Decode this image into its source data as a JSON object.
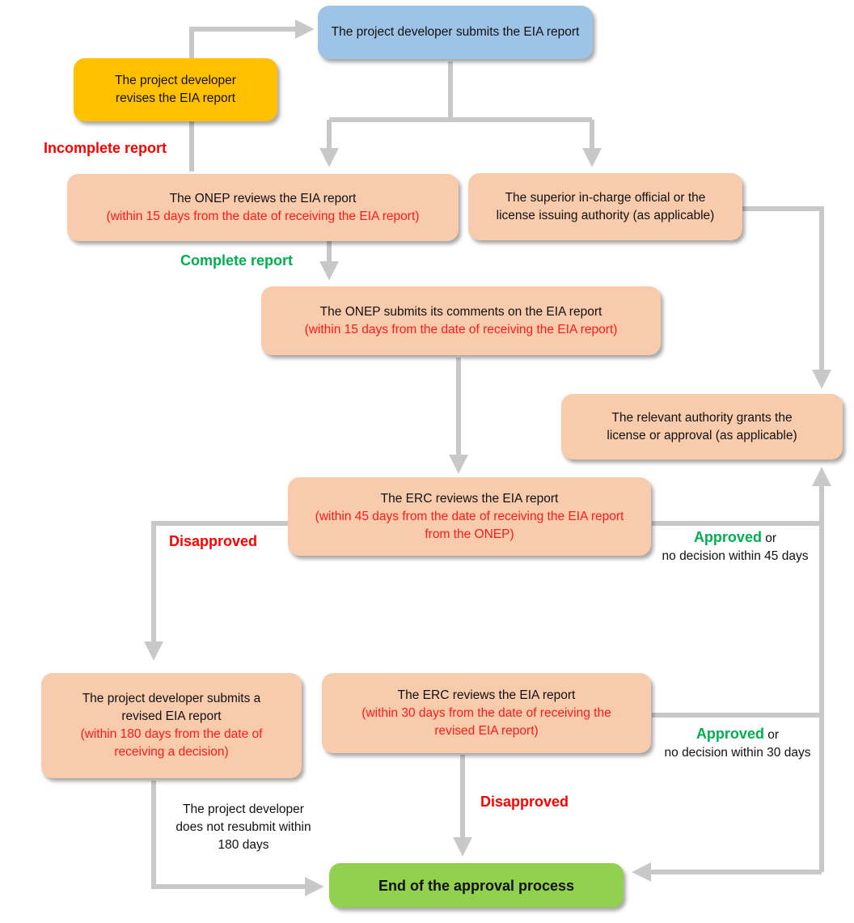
{
  "colors": {
    "submit_box": "#9dc3e6",
    "revise_box": "#ffc000",
    "process_box": "#f8cbad",
    "end_box": "#92d050",
    "deadline_text": "#ff1a1a",
    "negative_label": "#ff0000",
    "positive_label": "#00b050",
    "connector": "#c8c8c8"
  },
  "nodes": {
    "submit": {
      "text": "The project developer submits the EIA report"
    },
    "revise": {
      "text": "The project developer revises the EIA report"
    },
    "onep_review": {
      "text": "The ONEP reviews the EIA report",
      "note": "(within 15 days from the date of receiving the EIA report)"
    },
    "superior": {
      "text": "The superior in-charge official or the license issuing authority (as applicable)"
    },
    "onep_comments": {
      "text": "The ONEP submits its comments on the EIA report",
      "note": "(within 15 days from the date of receiving the EIA report)"
    },
    "grant": {
      "text": "The relevant authority grants the license or approval (as applicable)"
    },
    "erc_review_45": {
      "text": "The ERC reviews the EIA report",
      "note": "(within 45 days from the date of receiving the EIA report from the ONEP)"
    },
    "resubmit": {
      "text": "The project developer submits a revised EIA report",
      "note": "(within 180 days from the date of receiving a decision)"
    },
    "erc_review_30": {
      "text": "The ERC reviews the EIA report",
      "note": "(within 30 days from the date of receiving the revised EIA report)"
    },
    "end": {
      "text": "End of the approval process"
    }
  },
  "labels": {
    "incomplete": "Incomplete report",
    "complete": "Complete report",
    "disapproved_1": "Disapproved",
    "disapproved_2": "Disapproved",
    "approved_45_word": "Approved",
    "approved_45_or": " or",
    "approved_45_sub": "no decision within 45 days",
    "approved_30_word": "Approved",
    "approved_30_or": " or",
    "approved_30_sub": "no decision within 30 days",
    "no_resubmit": "The project developer does not resubmit within 180 days"
  }
}
